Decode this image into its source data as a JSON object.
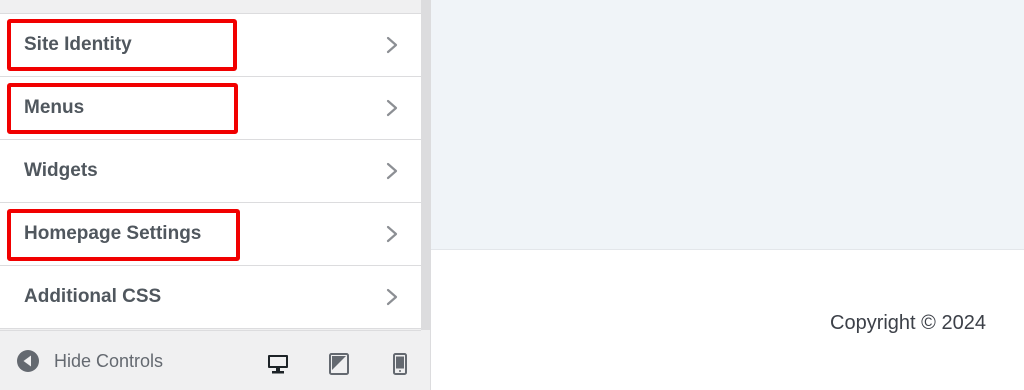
{
  "sidebar": {
    "items": [
      {
        "label": "Site Identity",
        "highlighted": true
      },
      {
        "label": "Menus",
        "highlighted": true
      },
      {
        "label": "Widgets",
        "highlighted": false
      },
      {
        "label": "Homepage Settings",
        "highlighted": true
      },
      {
        "label": "Additional CSS",
        "highlighted": false
      }
    ]
  },
  "footer": {
    "hide_controls_label": "Hide Controls",
    "devices": [
      "desktop-icon",
      "tablet-icon",
      "mobile-icon"
    ],
    "active_device": "desktop"
  },
  "preview": {
    "copyright": "Copyright © 2024"
  },
  "colors": {
    "highlight": "#f10000",
    "preview_bg": "#f0f4f8",
    "sidebar_bg": "#f0f0f1"
  }
}
